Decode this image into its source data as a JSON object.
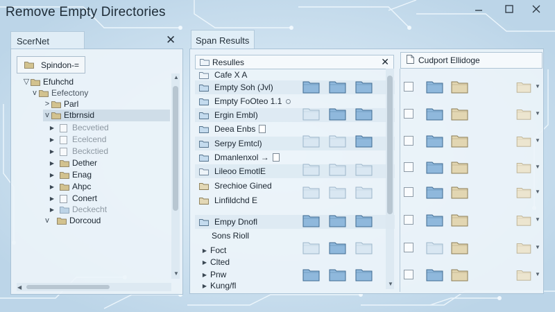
{
  "window": {
    "title": "Remove Empty Directories"
  },
  "left_panel": {
    "tab_label": "ScerNet",
    "root_button_label": "Spindon-=",
    "tree": [
      {
        "label": "Efuhchd",
        "marker": "▽"
      },
      {
        "label": "Eefectony",
        "marker": "v"
      },
      {
        "label": "Parl",
        "marker": ">"
      },
      {
        "label": "Etbrnsid",
        "marker": "v"
      },
      {
        "label": "Becvetied",
        "marker": "▶"
      },
      {
        "label": "Ecelcend",
        "marker": "▶"
      },
      {
        "label": "Beckctied",
        "marker": "▶"
      },
      {
        "label": "Dether",
        "marker": "▶"
      },
      {
        "label": "Enag",
        "marker": "▶"
      },
      {
        "label": "Ahpc",
        "marker": "▶"
      },
      {
        "label": "Conert",
        "marker": "▶"
      },
      {
        "label": "Deckecht",
        "marker": "▶"
      },
      {
        "label": "Dorcoud",
        "marker": "v"
      }
    ]
  },
  "right_panel": {
    "tab_label": "Span Results",
    "results_header": "Resulles",
    "export_header": "Cudport Ellidoge",
    "rows": [
      {
        "name": "Cafe X A"
      },
      {
        "name": "Empty Soh (Jvl)"
      },
      {
        "name": "Empty FoOteo 1.1"
      },
      {
        "name": "Ergin Embl)"
      },
      {
        "name": "Deea Enbs"
      },
      {
        "name": "Serpy Emtcl)"
      },
      {
        "name": "Dmanlenxol →"
      },
      {
        "name": "Lileoo EmotlE"
      },
      {
        "name": "Srechioe Gined"
      },
      {
        "name": "Linfildchd E"
      },
      {
        "name": "Empy Dnofl"
      },
      {
        "name": "Sons Rioll"
      },
      {
        "name": "Foct"
      },
      {
        "name": "Clted"
      },
      {
        "name": "Pnw"
      },
      {
        "name": "Kung/fl"
      }
    ]
  },
  "icons": {
    "folder": "folder-icon",
    "document": "document-icon",
    "close": "close-icon",
    "minimize": "minimize-icon",
    "maximize": "maximize-icon"
  },
  "colors": {
    "folder_blue": "#6b9dc9",
    "folder_tan": "#d6c9a6",
    "panel_bg": "#ecf4fa",
    "background": "#c6dcec"
  }
}
